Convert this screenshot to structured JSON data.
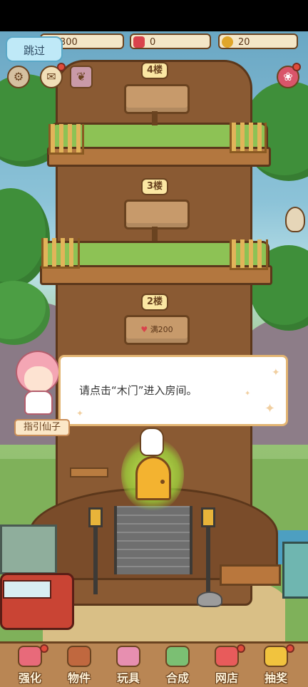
{
  "resources": {
    "coins": "300",
    "hearts": "0",
    "gold": "20"
  },
  "skip_label": "跳过",
  "floors": [
    {
      "label": "4楼",
      "sign_text": ""
    },
    {
      "label": "3楼",
      "sign_text": ""
    },
    {
      "label": "2楼",
      "sign_text": "满200"
    }
  ],
  "dialog": {
    "text": "请点击“木门”进入房间。",
    "speaker": "指引仙子"
  },
  "bottom_nav": [
    {
      "label": "强化",
      "icon": "swirl-candy-icon",
      "color": "#e86a7a",
      "badge": true
    },
    {
      "label": "物件",
      "icon": "piano-icon",
      "color": "#c0683f",
      "badge": false
    },
    {
      "label": "玩具",
      "icon": "toy-box-icon",
      "color": "#e78fb0",
      "badge": false
    },
    {
      "label": "合成",
      "icon": "cards-icon",
      "color": "#7bbf73",
      "badge": false
    },
    {
      "label": "网店",
      "icon": "shop-icon",
      "color": "#e85b5b",
      "badge": true
    },
    {
      "label": "抽奖",
      "icon": "lottery-wheel-icon",
      "color": "#f1c33e",
      "badge": true
    }
  ],
  "colors": {
    "dialog_border": "#e2b472",
    "skip_button": "#bfe9f7",
    "door": "#f3b330",
    "door_glow": "#a6e34a"
  }
}
